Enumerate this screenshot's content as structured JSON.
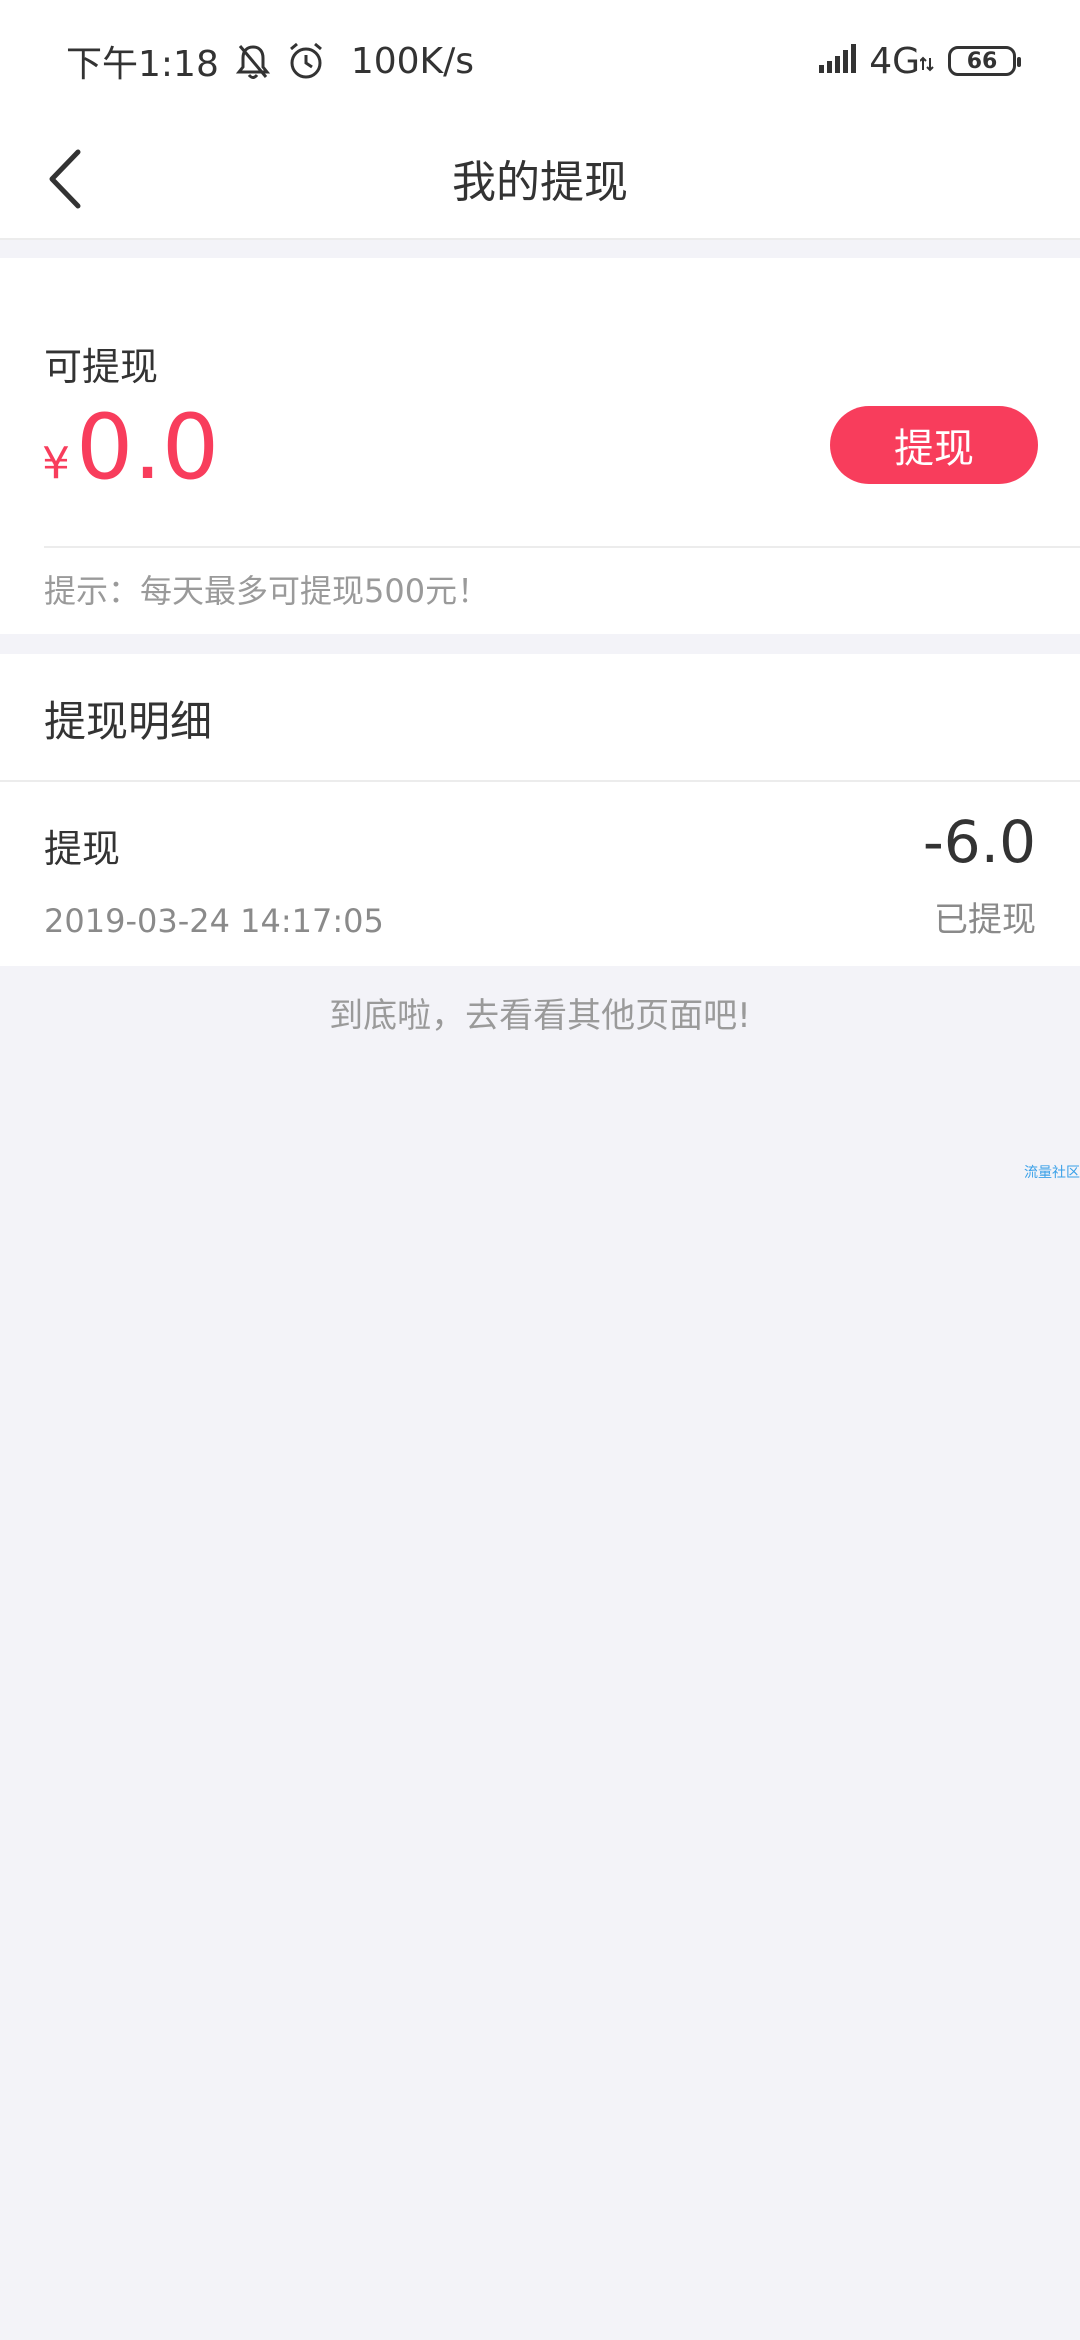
{
  "status_bar": {
    "time": "下午1:18",
    "speed": "100K/s",
    "network": "4G",
    "battery": "66"
  },
  "nav": {
    "title": "我的提现"
  },
  "balance": {
    "label": "可提现",
    "currency": "¥",
    "amount": "0.0",
    "button_label": "提现",
    "tip": "提示：每天最多可提现500元！"
  },
  "details": {
    "title": "提现明细",
    "records": [
      {
        "name": "提现",
        "time": "2019-03-24 14:17:05",
        "amount": "-6.0",
        "status": "已提现"
      }
    ],
    "end_text": "到底啦，去看看其他页面吧!"
  },
  "watermark": "流量社区",
  "colors": {
    "accent": "#f83d5c",
    "background": "#f3f3f8"
  }
}
